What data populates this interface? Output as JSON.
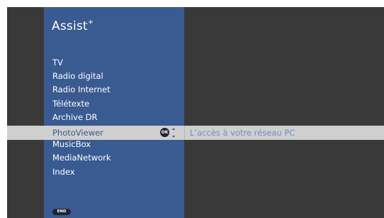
{
  "app": {
    "title": "Assist",
    "title_sup": "+"
  },
  "menu": {
    "items": [
      {
        "label": "TV"
      },
      {
        "label": "Radio digital"
      },
      {
        "label": "Radio Internet"
      },
      {
        "label": "Télétexte"
      },
      {
        "label": "Archive DR"
      },
      {
        "label": "PhotoViewer",
        "selected": true
      },
      {
        "label": "MusicBox"
      },
      {
        "label": "MediaNetwork"
      },
      {
        "label": "Index"
      }
    ]
  },
  "selection": {
    "label": "PhotoViewer",
    "ok_label": "OK",
    "description": "L’accès à votre réseau PC"
  },
  "footer": {
    "end_label": "END"
  },
  "colors": {
    "panel": "#3a5a92",
    "background": "#393939",
    "highlight": "#cfcfcf",
    "description": "#6f8fc8"
  }
}
